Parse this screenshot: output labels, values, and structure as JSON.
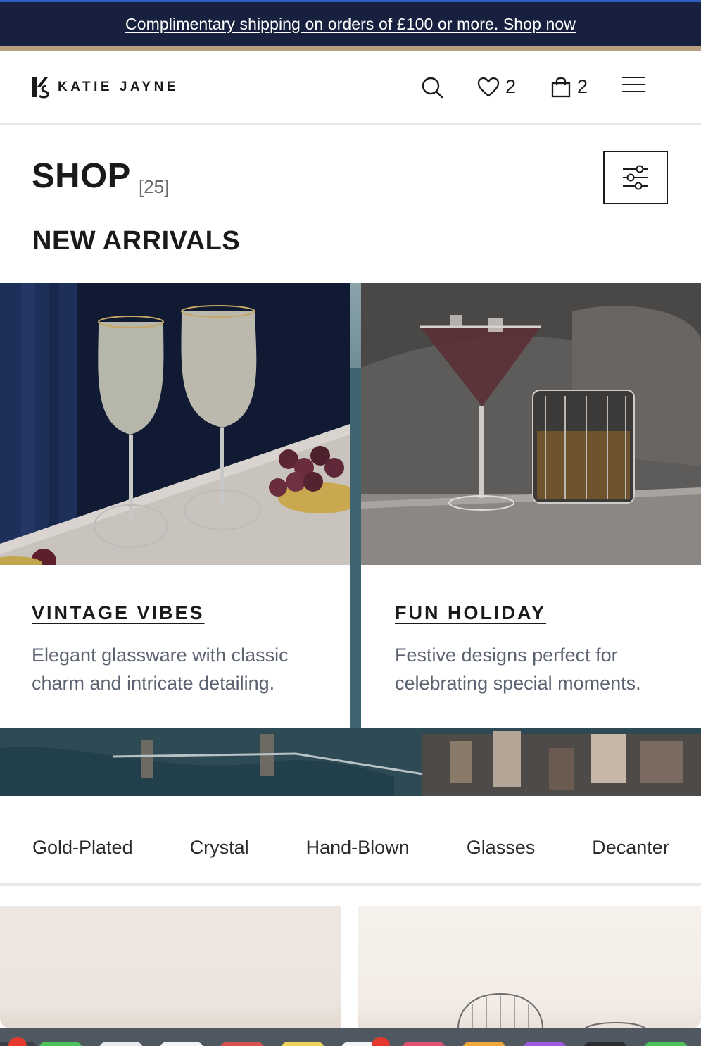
{
  "announcement": {
    "text": "Complimentary shipping on orders of £100 or more. Shop now"
  },
  "header": {
    "brand": "KATIE JAYNE",
    "wishlist_count": "2",
    "bag_count": "2"
  },
  "shop": {
    "title": "SHOP",
    "count": "[25]"
  },
  "section": {
    "title": "NEW ARRIVALS"
  },
  "collections": [
    {
      "title": "VINTAGE VIBES",
      "description": "Elegant glassware with classic charm and intricate detailing."
    },
    {
      "title": "FUN HOLIDAY",
      "description": "Festive designs perfect for celebrating special moments."
    }
  ],
  "categories": [
    "Gold-Plated",
    "Crystal",
    "Hand-Blown",
    "Glasses",
    "Decanters"
  ],
  "colors": {
    "announcement_bg": "#17213f",
    "accent_gold": "#b59f7d",
    "text_dark": "#1a1a1a",
    "text_muted": "#5b6270"
  }
}
